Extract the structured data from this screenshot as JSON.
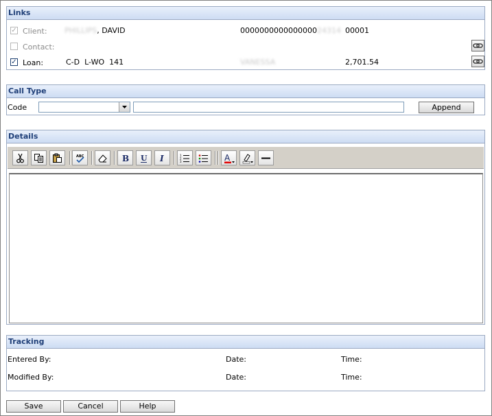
{
  "links": {
    "title": "Links",
    "client": {
      "label": "Client:",
      "name_blurred": "PHILLIPS",
      "name": ", DAVID",
      "account": "0000000000000000",
      "account_blurred": "24314",
      "code": "00001"
    },
    "contact": {
      "label": "Contact:"
    },
    "loan": {
      "label": "Loan:",
      "type": "C-D  L-WO  141",
      "officer_blurred": "VANESSA",
      "amount": "2,701.54"
    }
  },
  "call_type": {
    "title": "Call Type",
    "code_label": "Code",
    "code_value": "",
    "text_value": "",
    "append_label": "Append"
  },
  "details": {
    "title": "Details",
    "toolbar": [
      "cut-icon",
      "copy-icon",
      "paste-icon",
      "spellcheck-icon",
      "eraser-icon",
      "bold-icon",
      "underline-icon",
      "italic-icon",
      "numbered-list-icon",
      "bullet-list-icon",
      "font-color-icon",
      "highlight-icon",
      "horizontal-rule-icon"
    ],
    "content": ""
  },
  "tracking": {
    "title": "Tracking",
    "entered_by_label": "Entered By:",
    "modified_by_label": "Modified By:",
    "date_label": "Date:",
    "time_label": "Time:"
  },
  "buttons": {
    "save": "Save",
    "cancel": "Cancel",
    "help": "Help"
  }
}
